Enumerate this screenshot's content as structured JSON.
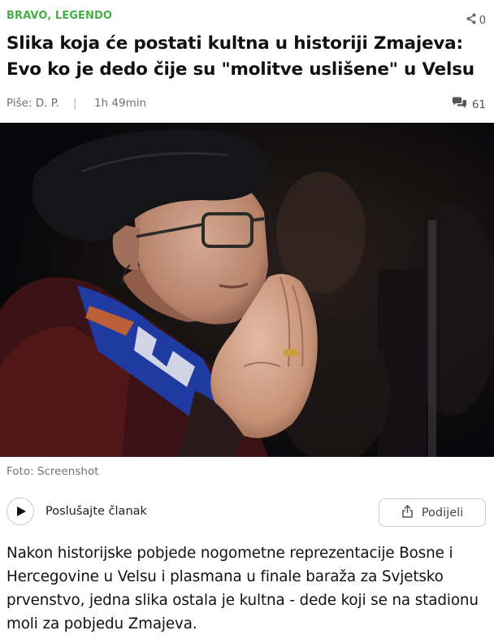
{
  "article": {
    "category": "BRAVO, LEGENDO",
    "share_count": "0",
    "title": "Slika koja će postati kultna u historiji Zmajeva: Evo ko je dedo čije su \"molitve uslišene\" u Velsu",
    "author": "Piše: D. P.",
    "separator": "|",
    "time_ago": "1h 49min",
    "comment_count": "61",
    "image_caption": "Foto: Screenshot",
    "listen_label": "Poslušajte članak",
    "share_label": "Podijeli",
    "lead": "Nakon historijske pobjede nogometne reprezentacije Bosne i Hercegovine u Velsu i plasmana u finale baraža za Svjetsko prvenstvo, jedna slika ostala je kultna - dede koji se na stadionu moli za pobjedu Zmajeva."
  },
  "icons": {
    "share": "share-icon",
    "comments": "comments-icon",
    "play": "play-icon",
    "upload": "upload-icon"
  },
  "colors": {
    "category": "#47b046",
    "meta_text": "#6f6f6f",
    "border": "#cfcfcf"
  }
}
